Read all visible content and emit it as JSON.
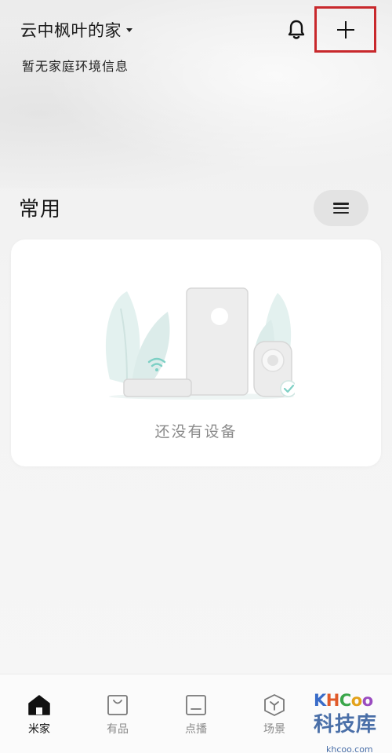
{
  "header": {
    "home_name": "云中枫叶的家",
    "home_info": "暂无家庭环境信息",
    "bell_icon": "bell-icon",
    "add_icon": "plus-icon",
    "highlight_color": "#c8282c"
  },
  "section": {
    "title": "常用",
    "menu_icon": "hamburger-menu-icon"
  },
  "device_card": {
    "empty_text": "还没有设备"
  },
  "tabbar": {
    "items": [
      {
        "label": "米家",
        "icon": "home-icon",
        "active": true
      },
      {
        "label": "有品",
        "icon": "shopping-bag-icon",
        "active": false
      },
      {
        "label": "点播",
        "icon": "video-icon",
        "active": false
      },
      {
        "label": "场景",
        "icon": "scene-cube-icon",
        "active": false
      }
    ]
  },
  "watermark": {
    "brand": "KHCoo",
    "site_name": "科技库",
    "url": "khcoo.com"
  }
}
